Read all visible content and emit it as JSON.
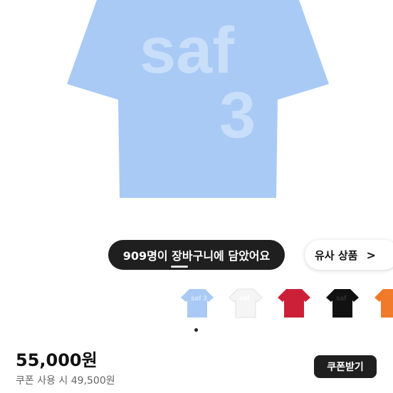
{
  "product": {
    "shirt_print_word": "saf",
    "shirt_print_number": "3",
    "colors": [
      {
        "name": "sky-blue",
        "hex": "#a9caf5",
        "print": "saf 3"
      },
      {
        "name": "white",
        "hex": "#f5f5f5",
        "print": "saf"
      },
      {
        "name": "red",
        "hex": "#cc2038",
        "print": ""
      },
      {
        "name": "black",
        "hex": "#111111",
        "print": "saf"
      },
      {
        "name": "orange",
        "hex": "#f07a2a",
        "print": ""
      }
    ]
  },
  "toast": {
    "text": "909명이 장바구니에 담았어요"
  },
  "similar": {
    "label": "유사 상품",
    "chevron": ">"
  },
  "pricing": {
    "price": "55,000원",
    "coupon_text": "쿠폰 사용 시 49,500원"
  },
  "coupon_button": {
    "label": "쿠폰받기"
  },
  "colors": {
    "shirt_blue": "#a9caf5",
    "dark_pill": "#1f1f1f"
  }
}
